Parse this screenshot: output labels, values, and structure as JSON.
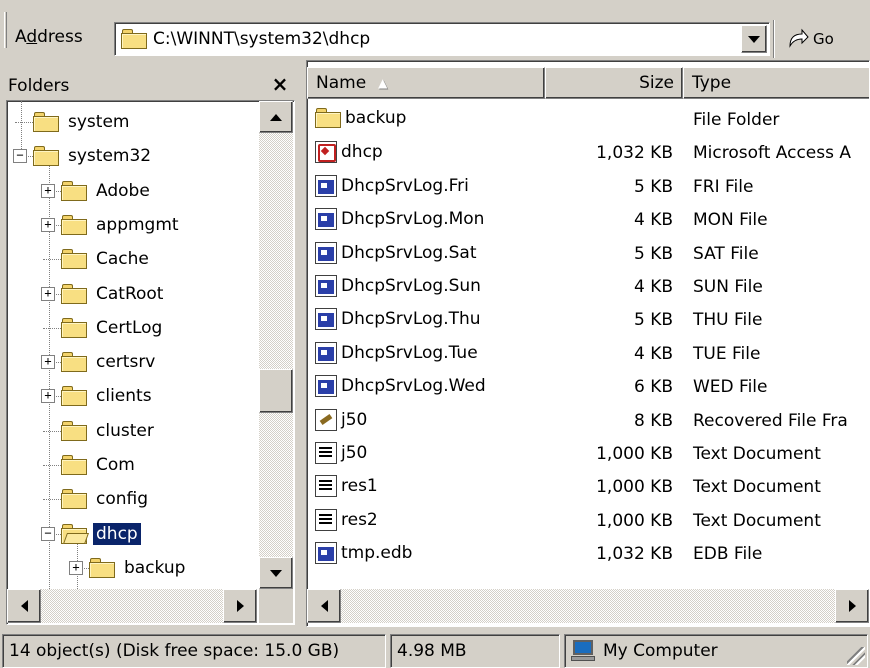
{
  "address": {
    "label": "Address",
    "path": "C:\\WINNT\\system32\\dhcp",
    "go_label": "Go"
  },
  "folders": {
    "title": "Folders",
    "close_label": "×",
    "tree": [
      {
        "label": "system",
        "expander": "",
        "selected": false
      },
      {
        "label": "system32",
        "expander": "−",
        "selected": false
      },
      {
        "label": "Adobe",
        "expander": "+",
        "selected": false
      },
      {
        "label": "appmgmt",
        "expander": "+",
        "selected": false
      },
      {
        "label": "Cache",
        "expander": "",
        "selected": false
      },
      {
        "label": "CatRoot",
        "expander": "+",
        "selected": false
      },
      {
        "label": "CertLog",
        "expander": "",
        "selected": false
      },
      {
        "label": "certsrv",
        "expander": "+",
        "selected": false
      },
      {
        "label": "clients",
        "expander": "+",
        "selected": false
      },
      {
        "label": "cluster",
        "expander": "",
        "selected": false
      },
      {
        "label": "Com",
        "expander": "",
        "selected": false
      },
      {
        "label": "config",
        "expander": "",
        "selected": false
      },
      {
        "label": "dhcp",
        "expander": "−",
        "selected": true
      },
      {
        "label": "backup",
        "expander": "+",
        "selected": false
      }
    ]
  },
  "file_list": {
    "columns": {
      "name": "Name",
      "size": "Size",
      "type": "Type"
    },
    "rows": [
      {
        "name": "backup",
        "size": "",
        "type": "File Folder",
        "icon": "folder-icon"
      },
      {
        "name": "dhcp",
        "size": "1,032 KB",
        "type": "Microsoft Access A",
        "icon": "access-db-icon"
      },
      {
        "name": "DhcpSrvLog.Fri",
        "size": "5 KB",
        "type": "FRI File",
        "icon": "generic-file-icon"
      },
      {
        "name": "DhcpSrvLog.Mon",
        "size": "4 KB",
        "type": "MON File",
        "icon": "generic-file-icon"
      },
      {
        "name": "DhcpSrvLog.Sat",
        "size": "5 KB",
        "type": "SAT File",
        "icon": "generic-file-icon"
      },
      {
        "name": "DhcpSrvLog.Sun",
        "size": "4 KB",
        "type": "SUN File",
        "icon": "generic-file-icon"
      },
      {
        "name": "DhcpSrvLog.Thu",
        "size": "5 KB",
        "type": "THU File",
        "icon": "generic-file-icon"
      },
      {
        "name": "DhcpSrvLog.Tue",
        "size": "4 KB",
        "type": "TUE File",
        "icon": "generic-file-icon"
      },
      {
        "name": "DhcpSrvLog.Wed",
        "size": "6 KB",
        "type": "WED File",
        "icon": "generic-file-icon"
      },
      {
        "name": "j50",
        "size": "8 KB",
        "type": "Recovered File Fra",
        "icon": "recovered-file-icon"
      },
      {
        "name": "j50",
        "size": "1,000 KB",
        "type": "Text Document",
        "icon": "text-document-icon"
      },
      {
        "name": "res1",
        "size": "1,000 KB",
        "type": "Text Document",
        "icon": "text-document-icon"
      },
      {
        "name": "res2",
        "size": "1,000 KB",
        "type": "Text Document",
        "icon": "text-document-icon"
      },
      {
        "name": "tmp.edb",
        "size": "1,032 KB",
        "type": "EDB File",
        "icon": "generic-file-icon"
      }
    ]
  },
  "status": {
    "objects": "14 object(s) (Disk free space: 15.0 GB)",
    "size": "4.98 MB",
    "zone": "My Computer"
  }
}
